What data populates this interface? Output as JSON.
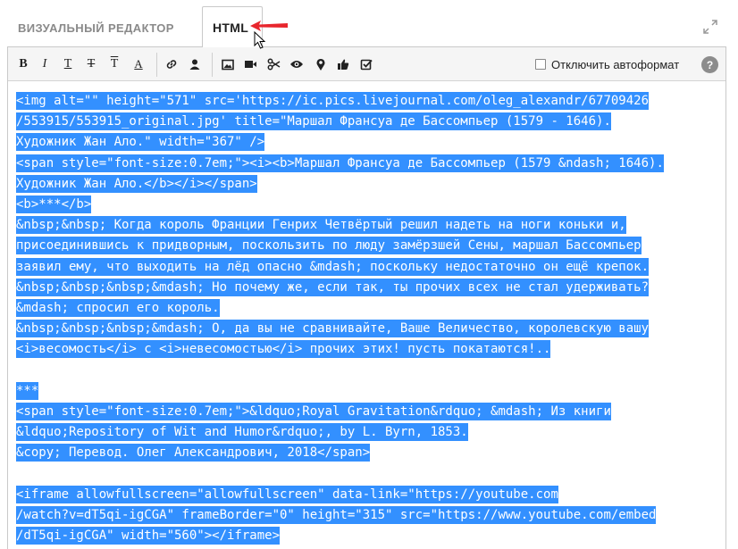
{
  "tabs": {
    "visual_label": "ВИЗУАЛЬНЫЙ РЕДАКТОР",
    "html_label": "HTML"
  },
  "toolbar": {
    "bold": "B",
    "italic": "I",
    "underline": "T",
    "strike": "T",
    "superscript": "T",
    "text_color": "A",
    "autoformat_label": "Отключить автоформат",
    "help": "?"
  },
  "colors": {
    "selection": "#3390ff",
    "arrow": "#e8262d"
  },
  "code_lines": [
    "<img alt=\"\" height=\"571\" src='https://ic.pics.livejournal.com/oleg_alexandr/67709426",
    "/553915/553915_original.jpg' title=\"Маршал Франсуа де Бассомпьер (1579 - 1646).",
    "Художник Жан Ало.\" width=\"367\" />",
    "<span style=\"font-size:0.7em;\"><i><b>Маршал Франсуа де Бассомпьер (1579 &ndash; 1646).",
    "Художник Жан Ало.</b></i></span>",
    "<b>***</b>",
    "&nbsp;&nbsp; Когда король Франции Генрих Четвёртый решил надеть на ноги коньки и,",
    "присоединившись к придворным, поскользить по люду замёрзшей Сены, маршал Бассомпьер",
    "заявил ему, что выходить на лёд опасно &mdash; поскольку недостаточно он ещё крепок.",
    "&nbsp;&nbsp;&nbsp;&mdash; Но почему же, если так, ты прочих всех не стал удерживать?",
    "&mdash; спросил его король.",
    "&nbsp;&nbsp;&nbsp;&mdash; О, да вы не сравнивайте, Ваше Величество, королевскую вашу",
    "<i>весомость</i> с <i>невесомостью</i> прочих этих! пусть покатаются!..",
    "",
    "***",
    "<span style=\"font-size:0.7em;\">&ldquo;Royal Gravitation&rdquo; &mdash; Из книги",
    "&ldquo;Repository of Wit and Humor&rdquo;, by L. Byrn, 1853.",
    "&copy; Перевод. Олег Александрович, 2018</span>",
    "",
    "<iframe allowfullscreen=\"allowfullscreen\" data-link=\"https://youtube.com",
    "/watch?v=dT5qi-igCGA\" frameBorder=\"0\" height=\"315\" src=\"https://www.youtube.com/embed",
    "/dT5qi-igCGA\" width=\"560\"></iframe>"
  ]
}
